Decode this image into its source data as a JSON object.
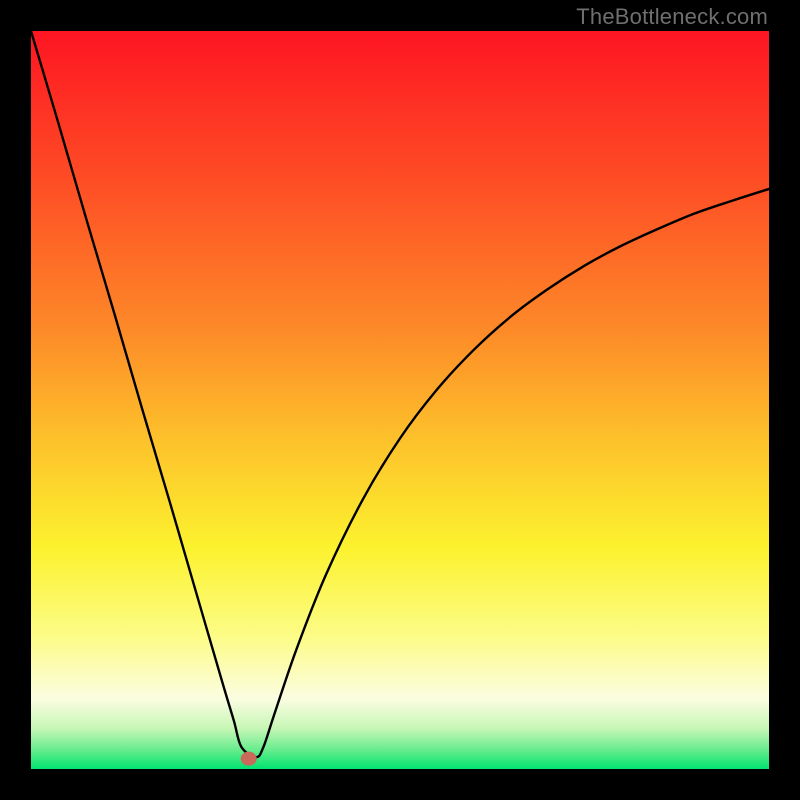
{
  "watermark": "TheBottleneck.com",
  "colors": {
    "frame": "#000000",
    "curve": "#000000",
    "marker": "#c96a5b",
    "gradient_top": "#fe1522",
    "gradient_mid_upper": "#fd9d29",
    "gradient_mid": "#fcf52f",
    "gradient_lower": "#fbfdbe",
    "gradient_bottom": "#00e36f"
  },
  "chart_data": {
    "type": "line",
    "title": "",
    "xlabel": "",
    "ylabel": "",
    "xlim": [
      0,
      100
    ],
    "ylim": [
      0,
      100
    ],
    "marker": {
      "x": 29.5,
      "y": 1.4
    },
    "series": [
      {
        "name": "bottleneck-curve",
        "x": [
          0,
          3.8,
          7.5,
          11.3,
          15.0,
          18.8,
          22.5,
          26.0,
          27.5,
          28.5,
          30.5,
          31.5,
          33.0,
          36.0,
          40.0,
          45.0,
          50.0,
          55.0,
          60.0,
          65.0,
          70.0,
          75.0,
          80.0,
          85.0,
          90.0,
          95.0,
          100.0
        ],
        "y": [
          100,
          87.2,
          74.5,
          61.7,
          49.0,
          36.2,
          23.5,
          11.5,
          6.5,
          3.0,
          1.6,
          3.0,
          7.5,
          16.3,
          26.4,
          36.6,
          44.8,
          51.4,
          56.8,
          61.3,
          65.0,
          68.2,
          70.9,
          73.2,
          75.3,
          77.0,
          78.6
        ]
      }
    ],
    "background_gradient_stops": [
      {
        "offset": 0.0,
        "color": "#fe1522"
      },
      {
        "offset": 0.2,
        "color": "#fe4c25"
      },
      {
        "offset": 0.4,
        "color": "#fd8828"
      },
      {
        "offset": 0.55,
        "color": "#fdc02b"
      },
      {
        "offset": 0.7,
        "color": "#fcf22e"
      },
      {
        "offset": 0.82,
        "color": "#fcfc87"
      },
      {
        "offset": 0.905,
        "color": "#fbfde1"
      },
      {
        "offset": 0.945,
        "color": "#c7f6b6"
      },
      {
        "offset": 0.975,
        "color": "#64ec8c"
      },
      {
        "offset": 1.0,
        "color": "#00e36f"
      }
    ]
  }
}
